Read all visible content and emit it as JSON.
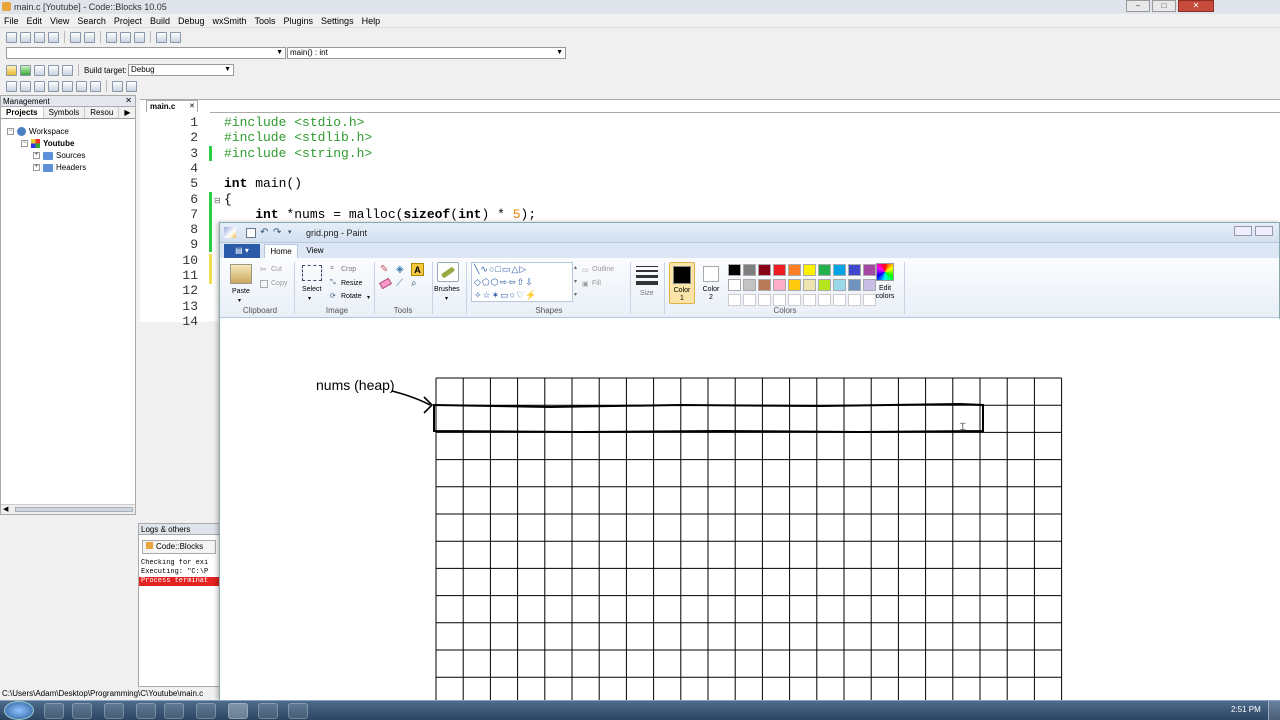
{
  "window": {
    "title": "main.c [Youtube] - Code::Blocks 10.05"
  },
  "menu": [
    "File",
    "Edit",
    "View",
    "Search",
    "Project",
    "Build",
    "Debug",
    "wxSmith",
    "Tools",
    "Plugins",
    "Settings",
    "Help"
  ],
  "toolbar": {
    "scope_combo": "",
    "function_combo": "main() : int",
    "build_target_label": "Build target:",
    "build_target_value": "Debug"
  },
  "management": {
    "header": "Management",
    "close_glyph": "✕",
    "tabs": [
      "Projects",
      "Symbols",
      "Resou"
    ],
    "tree": {
      "workspace": "Workspace",
      "project": "Youtube",
      "folders": [
        "Sources",
        "Headers"
      ]
    }
  },
  "logs": {
    "header": "Logs & others",
    "tab": "Code::Blocks",
    "lines": [
      "Checking for exi",
      "Executing: \"C:\\P",
      "Process terminat"
    ]
  },
  "editor": {
    "tab": "main.c",
    "tab_close": "✕",
    "line_numbers": [
      "1",
      "2",
      "3",
      "4",
      "5",
      "6",
      "7",
      "8",
      "9",
      "10",
      "11",
      "12",
      "13",
      "14"
    ],
    "code": {
      "l1": "#include <stdio.h>",
      "l2": "#include <stdlib.h>",
      "l3": "#include <string.h>",
      "l5_kw": "int",
      "l5_rest": " main()",
      "l6": "{",
      "l7_a": "    ",
      "l7_kw1": "int",
      "l7_b": " *nums = malloc(",
      "l7_kw2": "sizeof",
      "l7_c": "(",
      "l7_kw3": "int",
      "l7_d": ") * ",
      "l7_num": "5",
      "l7_e": ");"
    }
  },
  "status_bar": {
    "path": "C:\\Users\\Adam\\Desktop\\Programming\\C\\Youtube\\main.c"
  },
  "paint": {
    "title": "grid.png - Paint",
    "tabs": {
      "home": "Home",
      "view": "View"
    },
    "clipboard": {
      "paste": "Paste",
      "cut": "Cut",
      "copy": "Copy",
      "label": "Clipboard"
    },
    "image": {
      "select": "Select",
      "crop": "Crop",
      "resize": "Resize",
      "rotate": "Rotate",
      "label": "Image"
    },
    "tools_label": "Tools",
    "brushes": "Brushes",
    "shapes": {
      "outline": "Outline",
      "fill": "Fill",
      "label": "Shapes"
    },
    "size": "Size",
    "color1": {
      "line1": "Color",
      "line2": "1"
    },
    "color2": {
      "line1": "Color",
      "line2": "2"
    },
    "colors_label": "Colors",
    "edit_colors": {
      "line1": "Edit",
      "line2": "colors"
    },
    "palette_row1": [
      "#000000",
      "#7f7f7f",
      "#880015",
      "#ed1c24",
      "#ff7f27",
      "#fff200",
      "#22b14c",
      "#00a2e8",
      "#3f48cc",
      "#a349a4"
    ],
    "palette_row2": [
      "#ffffff",
      "#c3c3c3",
      "#b97a57",
      "#ffaec9",
      "#ffc90e",
      "#efe4b0",
      "#b5e61d",
      "#99d9ea",
      "#7092be",
      "#c8bfe7"
    ],
    "canvas_annotation": "nums (heap)"
  },
  "clock": "2:51 PM"
}
